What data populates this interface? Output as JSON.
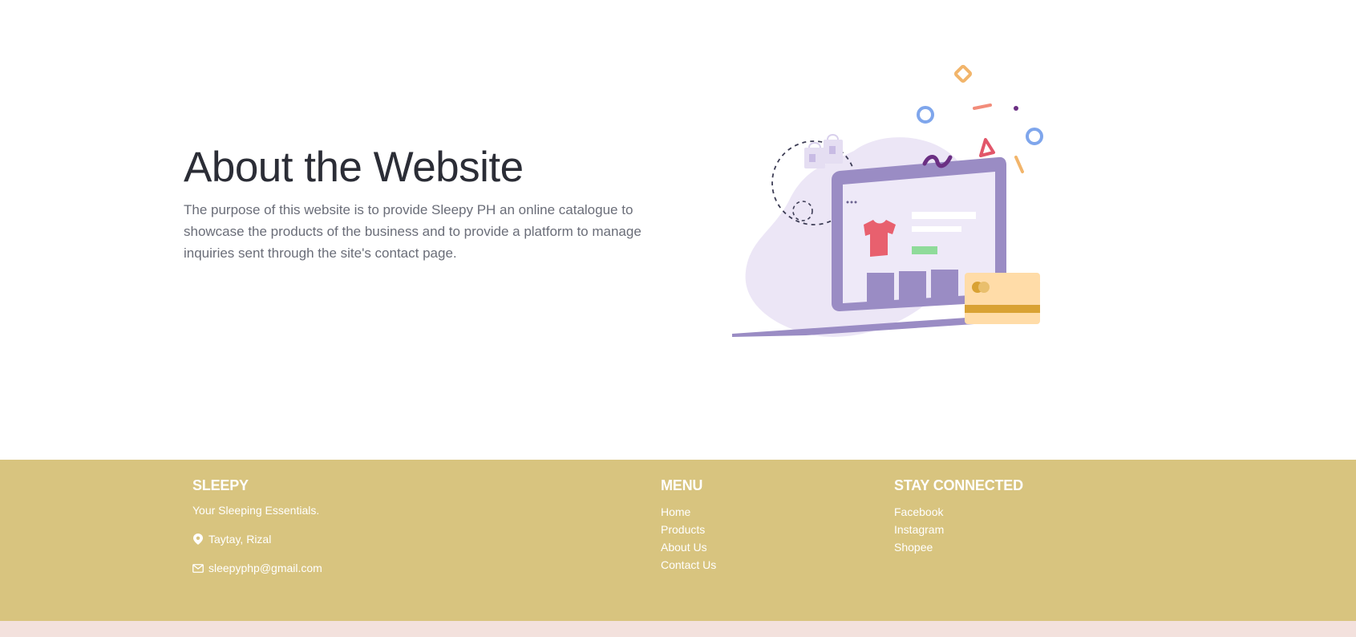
{
  "about": {
    "title": "About the Website",
    "description": "The purpose of this website is to provide Sleepy PH an online catalogue to showcase the products of the business and to provide a platform to manage inquiries sent through the site's contact page."
  },
  "illustration": {
    "icon": "online-shopping-illustration",
    "colors": {
      "blob": "#ece6f6",
      "laptop": "#9a8cc4",
      "screen": "#eee9f8",
      "shirt": "#e8606e",
      "card": "#ffdca8",
      "card_stripe": "#d9a233",
      "confetti_blue": "#7fa6ec",
      "confetti_orange": "#f2b56b",
      "confetti_red": "#e2566a",
      "confetti_purple": "#6b2f83"
    }
  },
  "footer": {
    "background": "#d8c47f",
    "brand": {
      "title": "SLEEPY",
      "tagline": "Your Sleeping Essentials.",
      "location_icon": "map-pin-icon",
      "location": "Taytay, Rizal",
      "email_icon": "mail-icon",
      "email": "sleepyphp@gmail.com"
    },
    "menu": {
      "title": "MENU",
      "items": [
        "Home",
        "Products",
        "About Us",
        "Contact Us"
      ]
    },
    "social": {
      "title": "STAY CONNECTED",
      "items": [
        "Facebook",
        "Instagram",
        "Shopee"
      ]
    }
  },
  "bottom_band_color": "#f3e1dd"
}
